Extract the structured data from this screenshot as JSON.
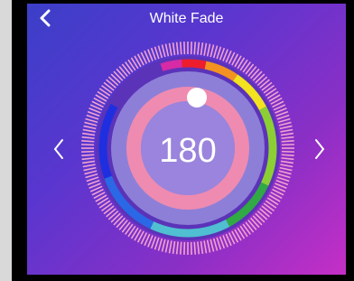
{
  "header": {
    "title": "White Fade"
  },
  "icons": {
    "back": "chevron-left-icon",
    "prev": "chevron-left-icon",
    "next": "chevron-right-icon"
  },
  "dial": {
    "value": "180",
    "color_segments": [
      "#d62aa6",
      "#ee1d2d",
      "#f39221",
      "#f2e21f",
      "#8ccf35",
      "#31a945",
      "#4fbfd1",
      "#2a68e6",
      "#1f2fe0"
    ],
    "ring_color": "#ef8bb0",
    "knob_color": "#ffffff"
  }
}
